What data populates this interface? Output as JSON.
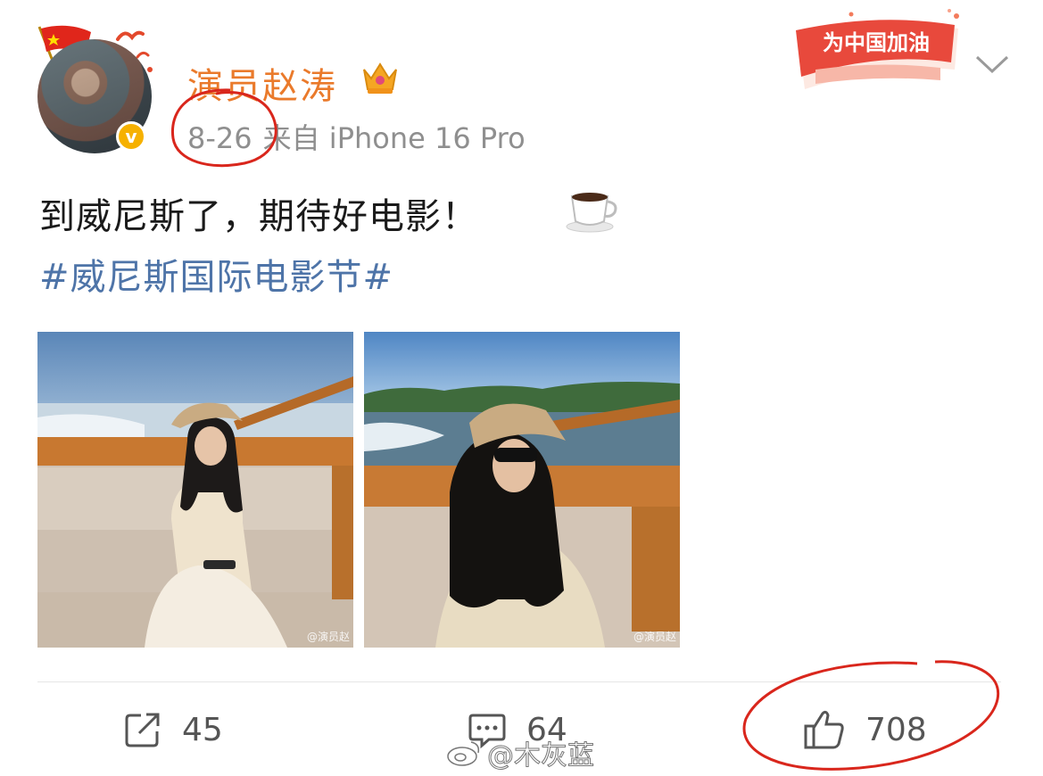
{
  "post": {
    "username": "演员赵涛",
    "date": "8-26",
    "source": "来自 iPhone 16 Pro",
    "text": "到威尼斯了，期待好电影！",
    "hashtag": "#威尼斯国际电影节#",
    "campaign_badge": "为中国加油",
    "photo_watermark": "@演员赵"
  },
  "actions": {
    "repost_count": "45",
    "comment_count": "64",
    "like_count": "708"
  },
  "overlay": {
    "watermark": "@木灰蓝"
  },
  "icons": {
    "avatar_badge": "verified-v-icon",
    "level_badge": "crown-icon",
    "emoji": "coffee-cup-icon",
    "menu": "chevron-down-icon",
    "repost": "share-square-icon",
    "comment": "comment-bubble-icon",
    "like": "thumbs-up-icon",
    "weibo_logo": "weibo-logo-icon"
  },
  "colors": {
    "username": "#ea7a2b",
    "hashtag": "#4e74a8",
    "meta": "#8f8f8f",
    "annotation": "#d9261c",
    "badge": "#f6b100"
  }
}
